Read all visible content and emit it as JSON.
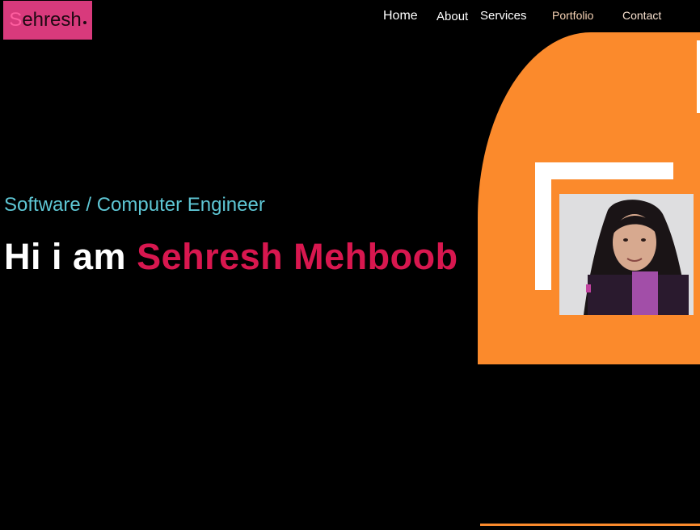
{
  "logo": {
    "initial": "S",
    "rest": "ehresh"
  },
  "nav": {
    "home": "Home",
    "about": "About",
    "services": "Services",
    "portfolio": "Portfolio",
    "contact": "Contact"
  },
  "hero": {
    "subtitle": "Software / Computer Engineer",
    "greeting": "Hi i am ",
    "name": "Sehresh Mehboob"
  },
  "colors": {
    "accent_pink": "#d83a7c",
    "name_red": "#d8174f",
    "subtitle_teal": "#5ec6d4",
    "blob_orange": "#fb8a2c"
  },
  "icons": {
    "profile_photo": "profile-photo"
  }
}
